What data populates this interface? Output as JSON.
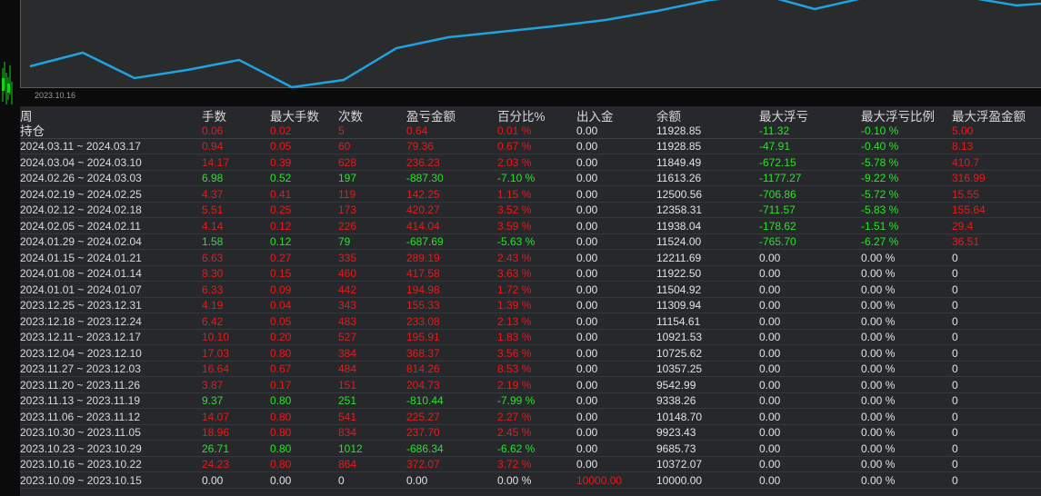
{
  "chart": {
    "date_label": "2023.10.16",
    "line_color": "#1fa3e0",
    "background": "#2a2b2d"
  },
  "table": {
    "headers": {
      "week": "周",
      "lots": "手数",
      "max_lots": "最大手数",
      "count": "次数",
      "pnl": "盈亏金额",
      "pct": "百分比%",
      "io": "出入金",
      "balance": "余额",
      "max_floating_loss": "最大浮亏",
      "max_floating_loss_ratio": "最大浮亏比例",
      "max_floating_profit": "最大浮盈金额"
    },
    "holding": {
      "week": "持仓",
      "lots": "0.06",
      "max_lots": "0.02",
      "count": "5",
      "pnl": "0.64",
      "pct": "0.01 %",
      "io": "0.00",
      "balance": "11928.85",
      "max_fl": "-11.32",
      "max_fl_ratio": "-0.10 %",
      "max_fp": "5.00",
      "colors": {
        "lots": "red",
        "max_lots": "red",
        "count": "red",
        "pnl": "red",
        "pct": "red",
        "max_fl": "green",
        "max_fl_ratio": "green",
        "max_fp": "red"
      }
    },
    "rows": [
      {
        "week": "2024.03.11 ~ 2024.03.17",
        "lots": "0.94",
        "max_lots": "0.05",
        "count": "60",
        "pnl": "79.36",
        "pct": "0.67 %",
        "io": "0.00",
        "balance": "11928.85",
        "max_fl": "-47.91",
        "max_fl_ratio": "-0.40 %",
        "max_fp": "8.13",
        "tone": "red",
        "fl_tone": "green"
      },
      {
        "week": "2024.03.04 ~ 2024.03.10",
        "lots": "14.17",
        "max_lots": "0.39",
        "count": "628",
        "pnl": "236.23",
        "pct": "2.03 %",
        "io": "0.00",
        "balance": "11849.49",
        "max_fl": "-672.15",
        "max_fl_ratio": "-5.78 %",
        "max_fp": "410.7",
        "tone": "red",
        "fl_tone": "green"
      },
      {
        "week": "2024.02.26 ~ 2024.03.03",
        "lots": "6.98",
        "max_lots": "0.52",
        "count": "197",
        "pnl": "-887.30",
        "pct": "-7.10 %",
        "io": "0.00",
        "balance": "11613.26",
        "max_fl": "-1177.27",
        "max_fl_ratio": "-9.22 %",
        "max_fp": "316.99",
        "tone": "green",
        "fl_tone": "green"
      },
      {
        "week": "2024.02.19 ~ 2024.02.25",
        "lots": "4.37",
        "max_lots": "0.41",
        "count": "119",
        "pnl": "142.25",
        "pct": "1.15 %",
        "io": "0.00",
        "balance": "12500.56",
        "max_fl": "-706.86",
        "max_fl_ratio": "-5.72 %",
        "max_fp": "15.55",
        "tone": "red",
        "fl_tone": "green"
      },
      {
        "week": "2024.02.12 ~ 2024.02.18",
        "lots": "5.51",
        "max_lots": "0.25",
        "count": "173",
        "pnl": "420.27",
        "pct": "3.52 %",
        "io": "0.00",
        "balance": "12358.31",
        "max_fl": "-711.57",
        "max_fl_ratio": "-5.83 %",
        "max_fp": "155.64",
        "tone": "red",
        "fl_tone": "green"
      },
      {
        "week": "2024.02.05 ~ 2024.02.11",
        "lots": "4.14",
        "max_lots": "0.12",
        "count": "226",
        "pnl": "414.04",
        "pct": "3.59 %",
        "io": "0.00",
        "balance": "11938.04",
        "max_fl": "-178.62",
        "max_fl_ratio": "-1.51 %",
        "max_fp": "29.4",
        "tone": "red",
        "fl_tone": "green"
      },
      {
        "week": "2024.01.29 ~ 2024.02.04",
        "lots": "1.58",
        "max_lots": "0.12",
        "count": "79",
        "pnl": "-687.69",
        "pct": "-5.63 %",
        "io": "0.00",
        "balance": "11524.00",
        "max_fl": "-765.70",
        "max_fl_ratio": "-6.27 %",
        "max_fp": "36.51",
        "tone": "green",
        "fl_tone": "green"
      },
      {
        "week": "2024.01.15 ~ 2024.01.21",
        "lots": "6.63",
        "max_lots": "0.27",
        "count": "335",
        "pnl": "289.19",
        "pct": "2.43 %",
        "io": "0.00",
        "balance": "12211.69",
        "max_fl": "0.00",
        "max_fl_ratio": "0.00 %",
        "max_fp": "0",
        "tone": "red",
        "fl_tone": "white"
      },
      {
        "week": "2024.01.08 ~ 2024.01.14",
        "lots": "8.30",
        "max_lots": "0.15",
        "count": "460",
        "pnl": "417.58",
        "pct": "3.63 %",
        "io": "0.00",
        "balance": "11922.50",
        "max_fl": "0.00",
        "max_fl_ratio": "0.00 %",
        "max_fp": "0",
        "tone": "red",
        "fl_tone": "white"
      },
      {
        "week": "2024.01.01 ~ 2024.01.07",
        "lots": "6.33",
        "max_lots": "0.09",
        "count": "442",
        "pnl": "194.98",
        "pct": "1.72 %",
        "io": "0.00",
        "balance": "11504.92",
        "max_fl": "0.00",
        "max_fl_ratio": "0.00 %",
        "max_fp": "0",
        "tone": "red",
        "fl_tone": "white"
      },
      {
        "week": "2023.12.25 ~ 2023.12.31",
        "lots": "4.19",
        "max_lots": "0.04",
        "count": "343",
        "pnl": "155.33",
        "pct": "1.39 %",
        "io": "0.00",
        "balance": "11309.94",
        "max_fl": "0.00",
        "max_fl_ratio": "0.00 %",
        "max_fp": "0",
        "tone": "red",
        "fl_tone": "white"
      },
      {
        "week": "2023.12.18 ~ 2023.12.24",
        "lots": "6.42",
        "max_lots": "0.05",
        "count": "483",
        "pnl": "233.08",
        "pct": "2.13 %",
        "io": "0.00",
        "balance": "11154.61",
        "max_fl": "0.00",
        "max_fl_ratio": "0.00 %",
        "max_fp": "0",
        "tone": "red",
        "fl_tone": "white"
      },
      {
        "week": "2023.12.11 ~ 2023.12.17",
        "lots": "10.10",
        "max_lots": "0.20",
        "count": "527",
        "pnl": "195.91",
        "pct": "1.83 %",
        "io": "0.00",
        "balance": "10921.53",
        "max_fl": "0.00",
        "max_fl_ratio": "0.00 %",
        "max_fp": "0",
        "tone": "red",
        "fl_tone": "white"
      },
      {
        "week": "2023.12.04 ~ 2023.12.10",
        "lots": "17.03",
        "max_lots": "0.80",
        "count": "384",
        "pnl": "368.37",
        "pct": "3.56 %",
        "io": "0.00",
        "balance": "10725.62",
        "max_fl": "0.00",
        "max_fl_ratio": "0.00 %",
        "max_fp": "0",
        "tone": "red",
        "fl_tone": "white"
      },
      {
        "week": "2023.11.27 ~ 2023.12.03",
        "lots": "16.64",
        "max_lots": "0.67",
        "count": "484",
        "pnl": "814.26",
        "pct": "8.53 %",
        "io": "0.00",
        "balance": "10357.25",
        "max_fl": "0.00",
        "max_fl_ratio": "0.00 %",
        "max_fp": "0",
        "tone": "red",
        "fl_tone": "white"
      },
      {
        "week": "2023.11.20 ~ 2023.11.26",
        "lots": "3.87",
        "max_lots": "0.17",
        "count": "151",
        "pnl": "204.73",
        "pct": "2.19 %",
        "io": "0.00",
        "balance": "9542.99",
        "max_fl": "0.00",
        "max_fl_ratio": "0.00 %",
        "max_fp": "0",
        "tone": "red",
        "fl_tone": "white"
      },
      {
        "week": "2023.11.13 ~ 2023.11.19",
        "lots": "9.37",
        "max_lots": "0.80",
        "count": "251",
        "pnl": "-810.44",
        "pct": "-7.99 %",
        "io": "0.00",
        "balance": "9338.26",
        "max_fl": "0.00",
        "max_fl_ratio": "0.00 %",
        "max_fp": "0",
        "tone": "green",
        "fl_tone": "white"
      },
      {
        "week": "2023.11.06 ~ 2023.11.12",
        "lots": "14.07",
        "max_lots": "0.80",
        "count": "541",
        "pnl": "225.27",
        "pct": "2.27 %",
        "io": "0.00",
        "balance": "10148.70",
        "max_fl": "0.00",
        "max_fl_ratio": "0.00 %",
        "max_fp": "0",
        "tone": "red",
        "fl_tone": "white"
      },
      {
        "week": "2023.10.30 ~ 2023.11.05",
        "lots": "18.96",
        "max_lots": "0.80",
        "count": "834",
        "pnl": "237.70",
        "pct": "2.45 %",
        "io": "0.00",
        "balance": "9923.43",
        "max_fl": "0.00",
        "max_fl_ratio": "0.00 %",
        "max_fp": "0",
        "tone": "red",
        "fl_tone": "white"
      },
      {
        "week": "2023.10.23 ~ 2023.10.29",
        "lots": "26.71",
        "max_lots": "0.80",
        "count": "1012",
        "pnl": "-686.34",
        "pct": "-6.62 %",
        "io": "0.00",
        "balance": "9685.73",
        "max_fl": "0.00",
        "max_fl_ratio": "0.00 %",
        "max_fp": "0",
        "tone": "green",
        "fl_tone": "white"
      },
      {
        "week": "2023.10.16 ~ 2023.10.22",
        "lots": "24.23",
        "max_lots": "0.80",
        "count": "864",
        "pnl": "372.07",
        "pct": "3.72 %",
        "io": "0.00",
        "balance": "10372.07",
        "max_fl": "0.00",
        "max_fl_ratio": "0.00 %",
        "max_fp": "0",
        "tone": "red",
        "fl_tone": "white"
      },
      {
        "week": "2023.10.09 ~ 2023.10.15",
        "lots": "0.00",
        "max_lots": "0.00",
        "count": "0",
        "pnl": "0.00",
        "pct": "0.00 %",
        "io": "10000.00",
        "balance": "10000.00",
        "max_fl": "0.00",
        "max_fl_ratio": "0.00 %",
        "max_fp": "0",
        "tone": "white",
        "fl_tone": "white",
        "io_tone": "red"
      }
    ]
  }
}
